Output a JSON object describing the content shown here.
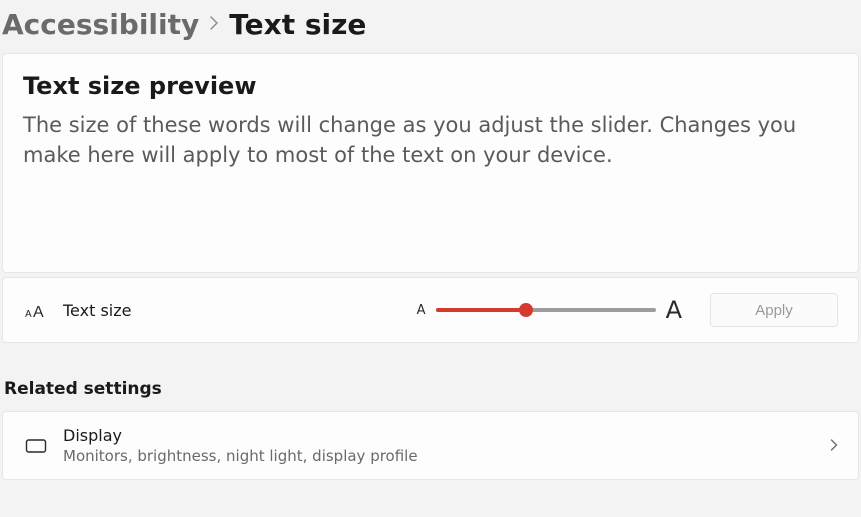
{
  "breadcrumb": {
    "parent": "Accessibility",
    "current": "Text size"
  },
  "preview": {
    "title": "Text size preview",
    "body": "The size of these words will change as you adjust the slider. Changes you make here will apply to most of the text on your device."
  },
  "slider_row": {
    "label": "Text size",
    "small_glyph": "A",
    "large_glyph": "A",
    "apply_label": "Apply",
    "apply_enabled": false,
    "slider_percent": 41
  },
  "related": {
    "header": "Related settings",
    "items": [
      {
        "title": "Display",
        "subtitle": "Monitors, brightness, night light, display profile"
      }
    ]
  }
}
